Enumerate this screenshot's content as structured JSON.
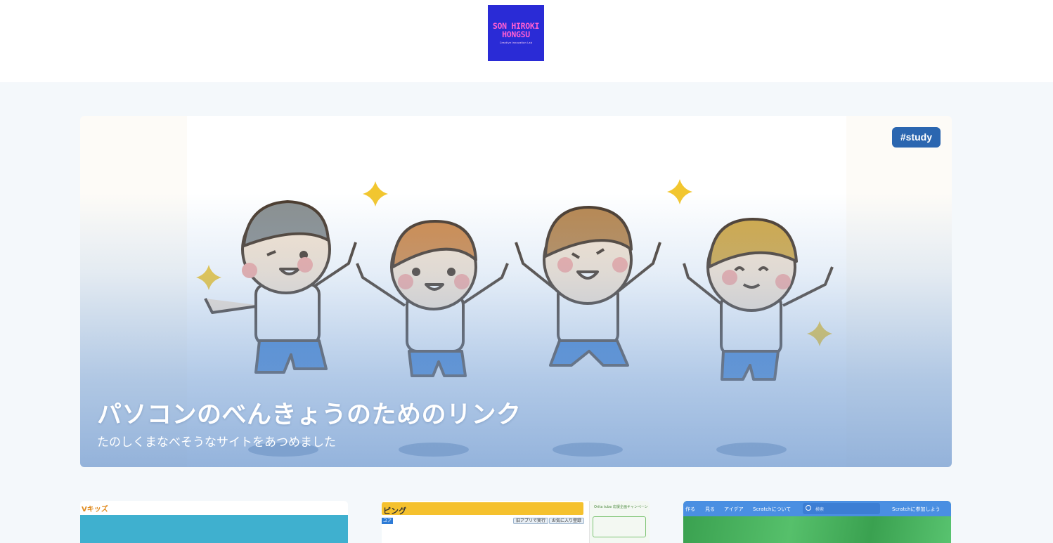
{
  "header": {
    "logo": {
      "line1": "SON HIROKI",
      "line2": "HONGSU",
      "tagline": "Creative Innovation Lab",
      "bg_color": "#2a2bd6",
      "text_color": "#ff5fd2"
    }
  },
  "hero": {
    "tag": "#study",
    "title": "パソコンのべんきょうのためのリンク",
    "subtitle": "たのしくまなべそうなサイトをあつめました",
    "image_description": "four cheerful kids jumping with sparkles",
    "tag_color": "#2b66b0"
  },
  "cards": [
    {
      "brand": "Vキッズ",
      "accent": "#3fb0cf"
    },
    {
      "title": "ピング",
      "badge": "ユア",
      "buttons": [
        "旧アプリで実行",
        "お気に入り登録"
      ],
      "side_text": "Orita tube 応援企画キャンペーン",
      "accent": "#f5c12e"
    },
    {
      "nav": [
        "作る",
        "見る",
        "アイデア",
        "Scratchについて"
      ],
      "search_placeholder": "検索",
      "join": "Scratchに参加しよう",
      "accent": "#4a8fe2"
    }
  ]
}
